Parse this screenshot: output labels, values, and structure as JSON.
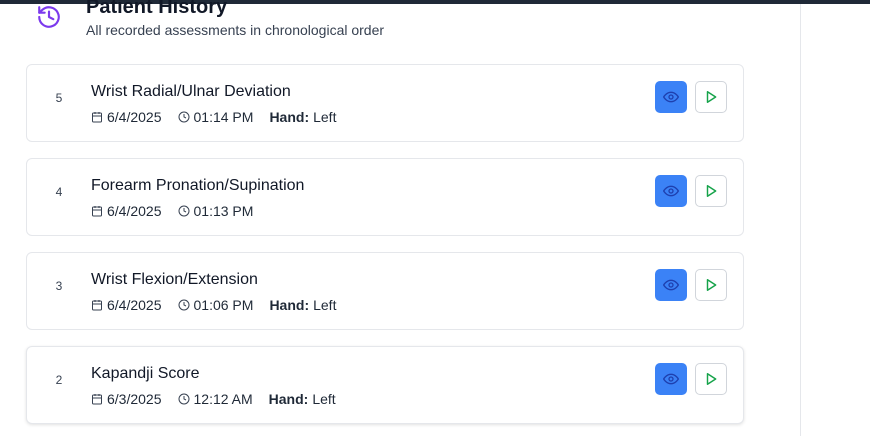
{
  "header": {
    "title": "Patient History",
    "subtitle": "All recorded assessments in chronological order",
    "icon": "history-icon"
  },
  "colors": {
    "accent": "#3b82f6",
    "title_icon": "#7c3aed",
    "play": "#16a34a"
  },
  "assessments": [
    {
      "index": "5",
      "name": "Wrist Radial/Ulnar Deviation",
      "date": "6/4/2025",
      "time": "01:14 PM",
      "hand_label": "Hand:",
      "hand": "Left"
    },
    {
      "index": "4",
      "name": "Forearm Pronation/Supination",
      "date": "6/4/2025",
      "time": "01:13 PM",
      "hand_label": "",
      "hand": ""
    },
    {
      "index": "3",
      "name": "Wrist Flexion/Extension",
      "date": "6/4/2025",
      "time": "01:06 PM",
      "hand_label": "Hand:",
      "hand": "Left"
    },
    {
      "index": "2",
      "name": "Kapandji Score",
      "date": "6/3/2025",
      "time": "12:12 AM",
      "hand_label": "Hand:",
      "hand": "Left"
    }
  ],
  "icons": {
    "date": "calendar-icon",
    "time": "clock-icon",
    "view": "eye-icon",
    "replay": "play-icon"
  }
}
